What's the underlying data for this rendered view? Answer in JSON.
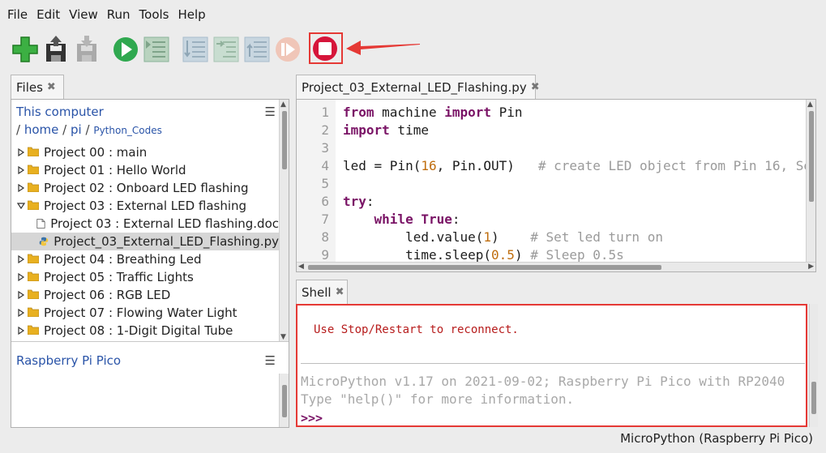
{
  "menu": [
    "File",
    "Edit",
    "View",
    "Run",
    "Tools",
    "Help"
  ],
  "toolbar": {
    "buttons": [
      "new-file",
      "load-file",
      "save-file",
      "run",
      "debug",
      "step-over",
      "step-into",
      "step-out",
      "resume",
      "stop"
    ]
  },
  "files_tab": {
    "label": "Files"
  },
  "this_computer": {
    "title": "This computer",
    "path": [
      "/",
      "home",
      "/",
      "pi",
      "/",
      "Python_Codes"
    ],
    "items": [
      {
        "label": "Project 00 : main",
        "type": "folder",
        "expanded": false
      },
      {
        "label": "Project 01 : Hello World",
        "type": "folder",
        "expanded": false
      },
      {
        "label": "Project 02 : Onboard LED flashing",
        "type": "folder",
        "expanded": false
      },
      {
        "label": "Project 03 : External LED flashing",
        "type": "folder",
        "expanded": true
      },
      {
        "label": "Project 03 : External LED flashing.doc",
        "type": "doc",
        "indent": true
      },
      {
        "label": "Project_03_External_LED_Flashing.py",
        "type": "py",
        "indent": true,
        "selected": true
      },
      {
        "label": "Project 04 : Breathing Led",
        "type": "folder",
        "expanded": false
      },
      {
        "label": "Project 05 : Traffic Lights",
        "type": "folder",
        "expanded": false
      },
      {
        "label": "Project 06 : RGB LED",
        "type": "folder",
        "expanded": false
      },
      {
        "label": "Project 07 : Flowing Water Light",
        "type": "folder",
        "expanded": false
      },
      {
        "label": "Project 08 : 1-Digit Digital Tube",
        "type": "folder",
        "expanded": false
      }
    ]
  },
  "pico": {
    "title": "Raspberry Pi Pico"
  },
  "editor_tab": {
    "label": "Project_03_External_LED_Flashing.py"
  },
  "code_lines": [
    "1",
    "2",
    "3",
    "4",
    "5",
    "6",
    "7",
    "8",
    "9"
  ],
  "shell_tab": {
    "label": "Shell"
  },
  "shell": {
    "reconnect": "Use Stop/Restart to reconnect.",
    "banner1": "MicroPython v1.17 on 2021-09-02; Raspberry Pi Pico with RP2040",
    "banner2": "Type \"help()\" for more information.",
    "prompt": ">>>"
  },
  "status": "MicroPython (Raspberry Pi Pico)",
  "colors": {
    "accent_red": "#e53935",
    "keyword": "#7a1466",
    "number": "#bf6d0d",
    "comment": "#9a9a9a",
    "link": "#2a54a8"
  }
}
